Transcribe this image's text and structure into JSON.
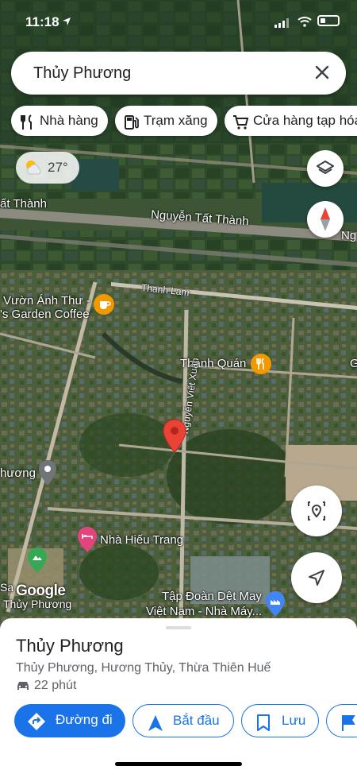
{
  "status_bar": {
    "time": "11:18"
  },
  "search": {
    "query": "Thủy Phương"
  },
  "chips": [
    {
      "label": "Nhà hàng",
      "icon": "restaurant-icon"
    },
    {
      "label": "Trạm xăng",
      "icon": "gas-station-icon"
    },
    {
      "label": "Cửa hàng tạp hóa",
      "icon": "cart-icon"
    }
  ],
  "weather": {
    "temp": "27°",
    "icon": "partly-cloudy-icon"
  },
  "map_labels": {
    "road_top": "ất Thành",
    "road_main": "Nguyễn Tất Thành",
    "road_right_edge": "Ng",
    "street_thanh_lam": "Thanh Lam",
    "poi_vuon_anh_thu_1": "Vườn Ánh Thư -",
    "poi_vuon_anh_thu_2": "'s Garden Coffee",
    "poi_thanh_quan": "Thành Quán",
    "right_edge_g": "G",
    "street_nguyen_viet_xuan": "Nguyễn Viết Xuân",
    "place_thuy_phuong_left": "hương",
    "poi_nha_hieu_trang": "Nhà Hiếu Trang",
    "left_sa": "Sa",
    "left_thuy_phuong": "Thủy Phương",
    "poi_tap_doan_1": "Tập Đoàn Dệt May",
    "poi_tap_doan_2": "Việt Nam - Nhà Máy...",
    "google_logo": "Google"
  },
  "colors": {
    "accent": "#1a73e8",
    "pin": "#ea4335",
    "cafe_poi": "#f29900",
    "hotel_poi": "#e2457b",
    "park_poi": "#34a853",
    "place_poi": "#70757a",
    "factory_poi": "#4285f4"
  },
  "sheet": {
    "title": "Thủy Phương",
    "address": "Thủy Phương, Hương Thủy, Thừa Thiên Huế",
    "eta": "22 phút",
    "buttons": {
      "directions": "Đường đi",
      "start": "Bắt đầu",
      "save": "Lưu"
    }
  }
}
